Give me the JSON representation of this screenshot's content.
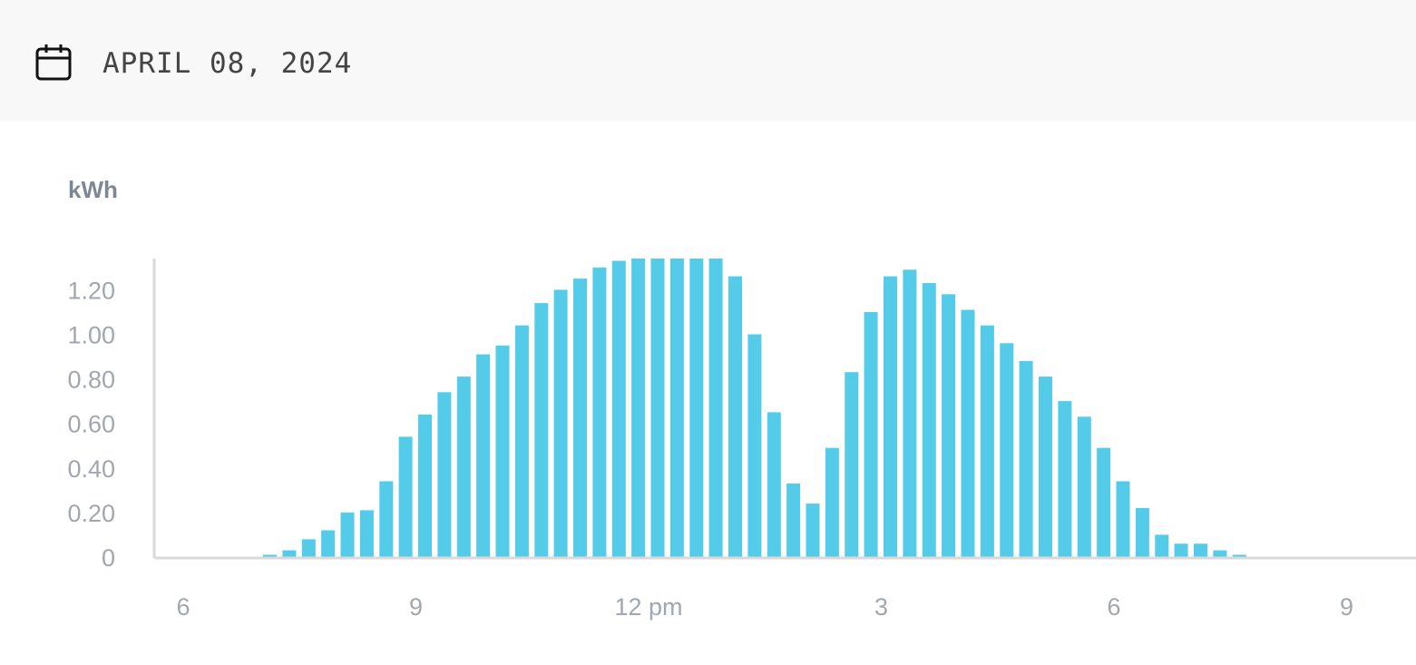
{
  "header": {
    "date": "APRIL 08, 2024",
    "icon": "calendar-icon"
  },
  "colors": {
    "bar": "#54cbe8",
    "axis": "#d9d9d9",
    "tick_text": "#a2a7af",
    "header_bg": "#f8f8f8"
  },
  "chart_data": {
    "type": "bar",
    "ylabel": "kWh",
    "xlabel": "",
    "ylim": [
      0,
      1.34
    ],
    "x_range_hours": [
      5.5,
      21.75
    ],
    "y_ticks": [
      {
        "value": 0,
        "label": "0"
      },
      {
        "value": 0.2,
        "label": "0.20"
      },
      {
        "value": 0.4,
        "label": "0.40"
      },
      {
        "value": 0.6,
        "label": "0.60"
      },
      {
        "value": 0.8,
        "label": "0.80"
      },
      {
        "value": 1.0,
        "label": "1.00"
      },
      {
        "value": 1.2,
        "label": "1.20"
      }
    ],
    "x_ticks": [
      {
        "hour": 6,
        "label": "6"
      },
      {
        "hour": 9,
        "label": "9"
      },
      {
        "hour": 12,
        "label": "12 pm"
      },
      {
        "hour": 15,
        "label": "3"
      },
      {
        "hour": 18,
        "label": "6"
      },
      {
        "hour": 21,
        "label": "9"
      }
    ],
    "interval_minutes": 15,
    "first_bar_start": "7:00",
    "values": [
      0.01,
      0.03,
      0.08,
      0.12,
      0.2,
      0.21,
      0.34,
      0.54,
      0.64,
      0.74,
      0.81,
      0.91,
      0.95,
      1.04,
      1.14,
      1.2,
      1.25,
      1.3,
      1.33,
      1.34,
      1.34,
      1.34,
      1.34,
      1.34,
      1.26,
      1.0,
      0.65,
      0.33,
      0.24,
      0.49,
      0.83,
      1.1,
      1.26,
      1.29,
      1.23,
      1.18,
      1.11,
      1.04,
      0.96,
      0.88,
      0.81,
      0.7,
      0.63,
      0.49,
      0.34,
      0.22,
      0.1,
      0.06,
      0.06,
      0.03,
      0.01
    ]
  }
}
